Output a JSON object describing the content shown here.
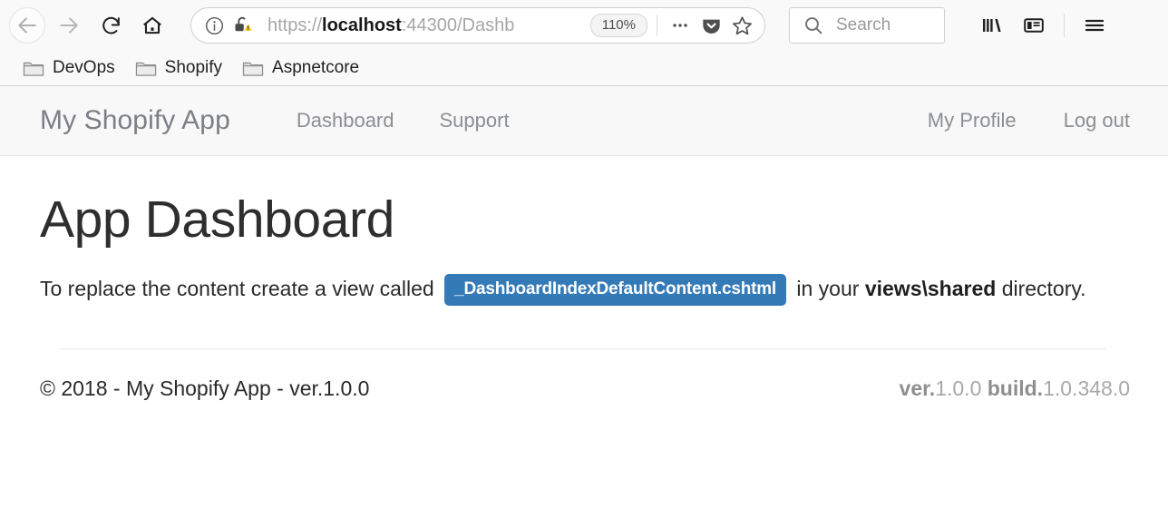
{
  "browser": {
    "nav": {
      "back": "back-arrow",
      "forward": "forward-arrow",
      "reload": "reload",
      "home": "home"
    },
    "url": {
      "scheme": "https://",
      "host": "localhost",
      "rest": ":44300/Dashb",
      "info_icon": "info-circle-icon",
      "security_icon": "broken-padlock-warning-icon"
    },
    "zoom_level": "110%",
    "page_actions_label": "•••",
    "search": {
      "placeholder": "Search"
    },
    "icons": {
      "library": "library-icon",
      "sidebar": "sidebar-icon",
      "menu": "hamburger-menu-icon",
      "pocket": "pocket-shield-icon",
      "bookmark_star": "star-icon",
      "search": "search-icon"
    },
    "bookmarks": [
      {
        "label": "DevOps",
        "icon": "folder-icon"
      },
      {
        "label": "Shopify",
        "icon": "folder-icon"
      },
      {
        "label": "Aspnetcore",
        "icon": "folder-icon"
      }
    ]
  },
  "navbar": {
    "brand": "My Shopify App",
    "links": [
      {
        "label": "Dashboard"
      },
      {
        "label": "Support"
      }
    ],
    "right_links": [
      {
        "label": "My Profile"
      },
      {
        "label": "Log out"
      }
    ]
  },
  "main": {
    "title": "App Dashboard",
    "lead_prefix": "To replace the content create a view called",
    "code_badge": "_DashboardIndexDefaultContent.cshtml",
    "lead_middle": "in your",
    "lead_bold": "views\\shared",
    "lead_suffix": "directory."
  },
  "footer": {
    "left": "© 2018 - My Shopify App - ver.1.0.0",
    "ver_label": "ver.",
    "ver_value": "1.0.0",
    "build_label": "build.",
    "build_value": "1.0.348.0"
  },
  "colors": {
    "badge_blue": "#337ab7",
    "navbar_bg": "#f8f8f8",
    "warning_yellow": "#f5c518"
  }
}
